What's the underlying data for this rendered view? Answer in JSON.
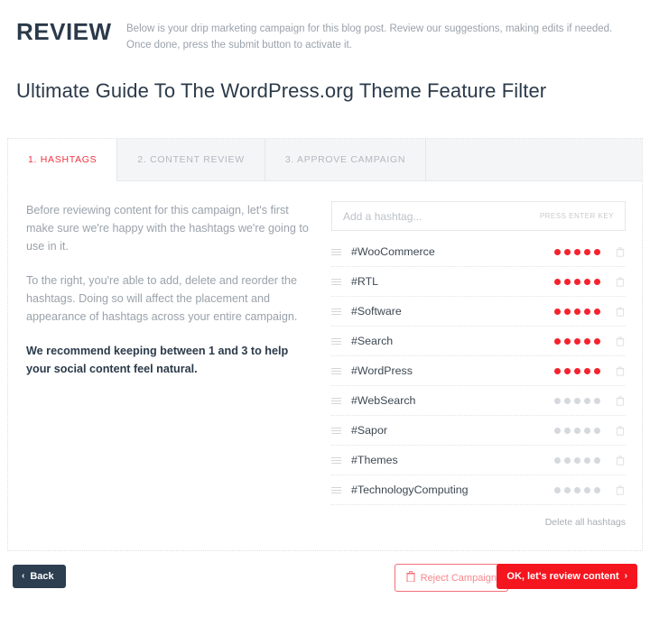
{
  "header": {
    "title": "REVIEW",
    "description": "Below is your drip marketing campaign for this blog post. Review our suggestions, making edits if needed. Once done, press the submit button to activate it."
  },
  "post_title": "Ultimate Guide To The WordPress.org Theme Feature Filter",
  "tabs": [
    {
      "label": "1. HASHTAGS",
      "active": true
    },
    {
      "label": "2. CONTENT REVIEW",
      "active": false
    },
    {
      "label": "3. APPROVE CAMPAIGN",
      "active": false
    }
  ],
  "instructions": {
    "paragraph_1": "Before reviewing content for this campaign, let's first make sure we're happy with the hashtags we're going to use in it.",
    "paragraph_2": "To the right, you're able to add, delete and reorder the hashtags. Doing so will affect the placement and appearance of hashtags across your entire campaign.",
    "paragraph_3": "We recommend keeping between 1 and 3 to help your social content feel natural."
  },
  "hashtag_input": {
    "value": "",
    "placeholder": "Add a hashtag...",
    "hint": "PRESS ENTER KEY"
  },
  "hashtags": [
    {
      "name": "#WooCommerce",
      "rating": 5
    },
    {
      "name": "#RTL",
      "rating": 5
    },
    {
      "name": "#Software",
      "rating": 5
    },
    {
      "name": "#Search",
      "rating": 5
    },
    {
      "name": "#WordPress",
      "rating": 5
    },
    {
      "name": "#WebSearch",
      "rating": 0
    },
    {
      "name": "#Sapor",
      "rating": 0
    },
    {
      "name": "#Themes",
      "rating": 0
    },
    {
      "name": "#TechnologyComputing",
      "rating": 0
    }
  ],
  "dots_per_row": 5,
  "delete_all_label": "Delete all hashtags",
  "footer": {
    "back_label": "Back",
    "back_chevron": "‹",
    "reject_label": "Reject Campaign",
    "ok_label": "OK, let's review content",
    "ok_chevron": "›"
  },
  "colors": {
    "accent_red": "#f5151f",
    "tab_active": "#ef3340",
    "dark_navy": "#2c3e50",
    "muted_text": "#9aa2ab",
    "dot_off": "#d5d8dc"
  }
}
